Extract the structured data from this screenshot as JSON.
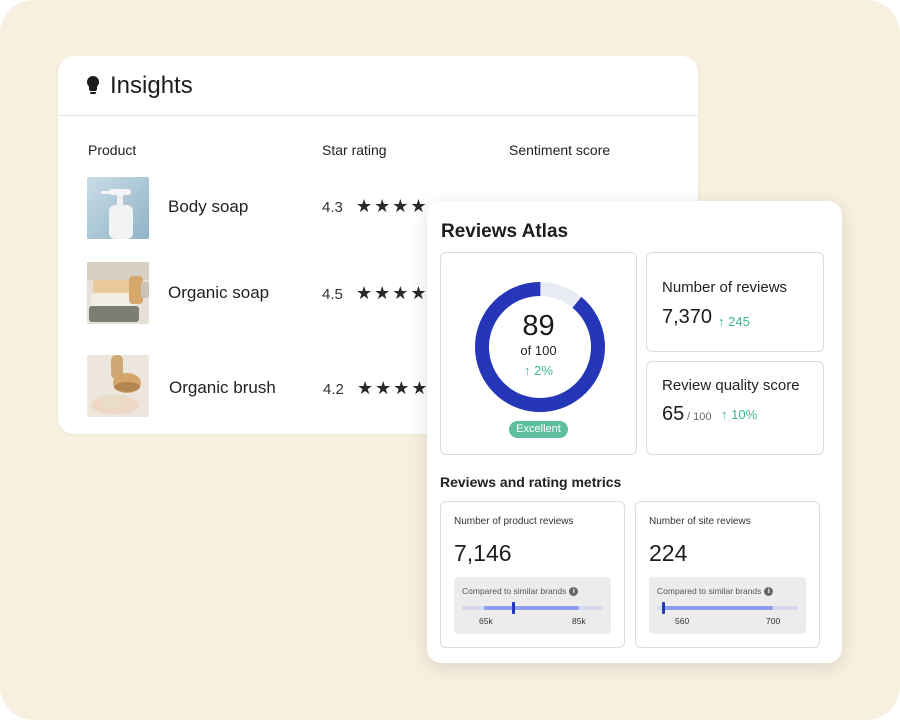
{
  "insights": {
    "title": "Insights",
    "columns": [
      "Product",
      "Star rating",
      "Sentiment score"
    ],
    "rows": [
      {
        "name": "Body soap",
        "rating": "4.3",
        "stars": "★★★★",
        "image": "pump-bottle-image"
      },
      {
        "name": "Organic soap",
        "rating": "4.5",
        "stars": "★★★★",
        "image": "soap-bars-image"
      },
      {
        "name": "Organic brush",
        "rating": "4.2",
        "stars": "★★★★",
        "image": "brush-image"
      }
    ]
  },
  "atlas": {
    "title": "Reviews Atlas",
    "score": {
      "value": "89",
      "of": "of 100",
      "change": "2%",
      "badge": "Excellent",
      "fraction": 0.89
    },
    "number_of_reviews": {
      "label": "Number of reviews",
      "value": "7,370",
      "change": "245"
    },
    "quality_score": {
      "label": "Review quality score",
      "value": "65",
      "of": "/ 100",
      "change": "10%"
    },
    "section_title": "Reviews and rating metrics",
    "product_reviews": {
      "label": "Number of product reviews",
      "value": "7,146",
      "compare_label": "Compared to similar brands",
      "min": "65k",
      "max": "85k",
      "range": {
        "min": 65000,
        "max": 85000,
        "value": 7146
      }
    },
    "site_reviews": {
      "label": "Number of site reviews",
      "value": "224",
      "compare_label": "Compared to similar brands",
      "min": "560",
      "max": "700",
      "range": {
        "min": 560,
        "max": 700,
        "value": 224
      }
    },
    "colors": {
      "ring": "#2536b8",
      "ring_track": "#e8ebf3",
      "positive": "#3fb78f",
      "badge": "#5cc09c",
      "bar": "#8e9df0"
    }
  }
}
